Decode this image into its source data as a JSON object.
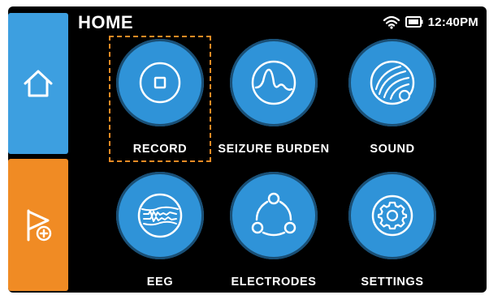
{
  "header": {
    "title": "HOME",
    "time": "12:40PM",
    "wifi_icon": "wifi-icon",
    "battery_icon": "battery-icon"
  },
  "sidebar": {
    "home_icon": "home-icon",
    "flag_icon": "flag-add-icon",
    "home_color": "#3d9fe0",
    "flag_color": "#f08b24"
  },
  "tiles": [
    {
      "label": "RECORD",
      "icon": "record-icon",
      "selected": true
    },
    {
      "label": "SEIZURE BURDEN",
      "icon": "seizure-burden-icon"
    },
    {
      "label": "SOUND",
      "icon": "sound-icon"
    },
    {
      "label": "EEG",
      "icon": "eeg-icon"
    },
    {
      "label": "ELECTRODES",
      "icon": "electrodes-icon"
    },
    {
      "label": "SETTINGS",
      "icon": "settings-icon"
    }
  ],
  "colors": {
    "tile_blue": "#2f93d8",
    "focus_orange": "#f08b24",
    "background": "#000000"
  }
}
